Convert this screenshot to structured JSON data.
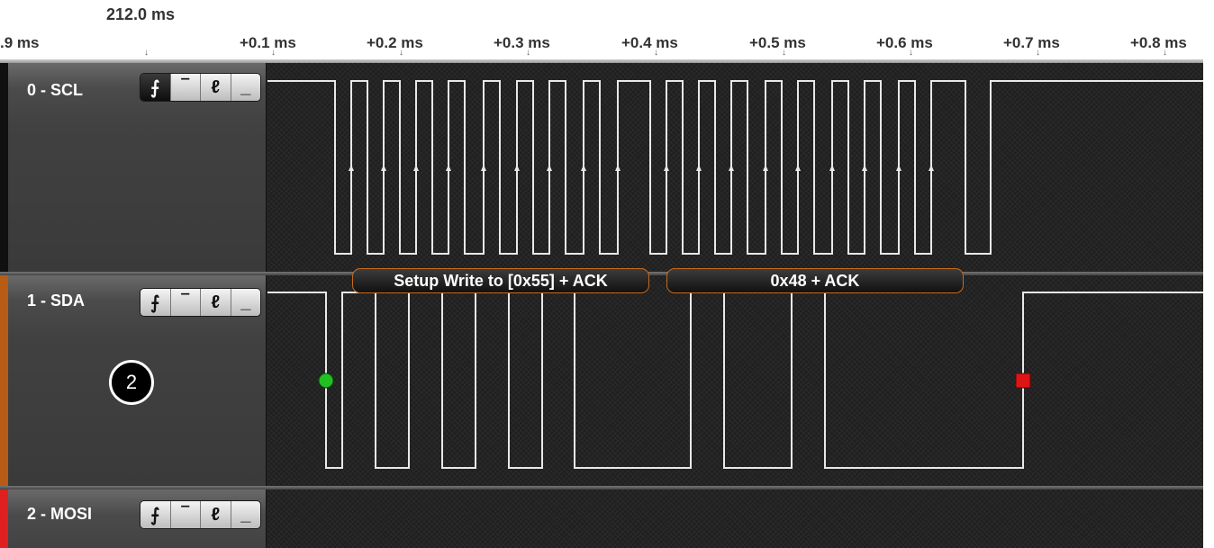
{
  "ruler": {
    "anchor_label": "212.0 ms",
    "ticks": [
      {
        "label": ".9 ms"
      },
      {
        "label": "+0.1 ms"
      },
      {
        "label": "+0.2 ms"
      },
      {
        "label": "+0.3 ms"
      },
      {
        "label": "+0.4 ms"
      },
      {
        "label": "+0.5 ms"
      },
      {
        "label": "+0.6 ms"
      },
      {
        "label": "+0.7 ms"
      },
      {
        "label": "+0.8 ms"
      }
    ]
  },
  "channels": [
    {
      "name": "0 - SCL",
      "color": "#101010",
      "active_trigger": "rising-edge"
    },
    {
      "name": "1 - SDA",
      "color": "#b85c15",
      "active_trigger": "none"
    },
    {
      "name": "2 - MOSI",
      "color": "#e02020",
      "active_trigger": "none"
    }
  ],
  "trigger_buttons": {
    "rising_edge": "⨍",
    "high": "‾",
    "falling_edge": "ℓ",
    "low": "_"
  },
  "decoded": {
    "packet1": "Setup Write to [0x55] + ACK",
    "packet2": "0x48 + ACK"
  },
  "markers": {
    "start_color": "#22c022",
    "stop_color": "#dd1515"
  },
  "step_badge": "2",
  "colors": {
    "waveform": "#e8e8e8",
    "label_border": "#c46a1e"
  }
}
